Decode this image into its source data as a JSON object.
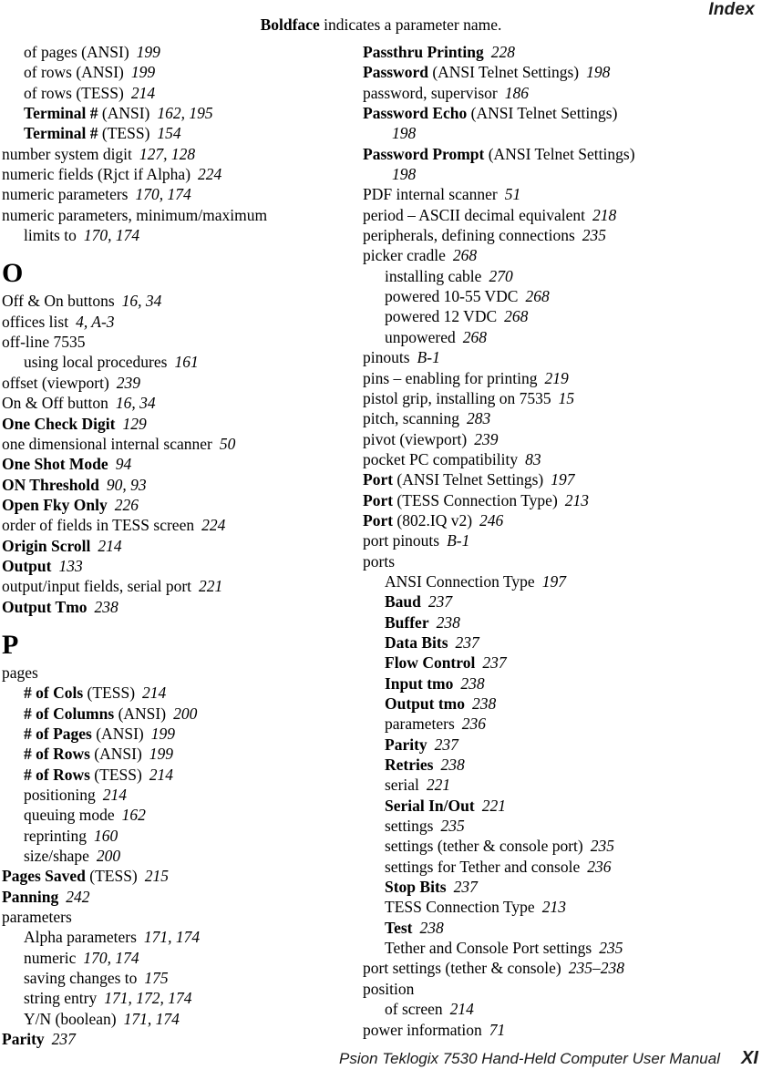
{
  "header": {
    "title": "Index"
  },
  "note": {
    "bold_word": "Boldface",
    "rest": " indicates a parameter name."
  },
  "footer": {
    "manual_title": "Psion Teklogix 7530 Hand-Held Computer User Manual",
    "page_number": "XI"
  },
  "columns": {
    "left": [
      {
        "kind": "entry",
        "level": 1,
        "bold": "",
        "text": "of pages (ANSI)",
        "pages": "199"
      },
      {
        "kind": "entry",
        "level": 1,
        "bold": "",
        "text": "of rows (ANSI)",
        "pages": "199"
      },
      {
        "kind": "entry",
        "level": 1,
        "bold": "",
        "text": "of rows (TESS)",
        "pages": "214"
      },
      {
        "kind": "entry",
        "level": 1,
        "bold": "Terminal #",
        "text": " (ANSI)",
        "pages": "162, 195"
      },
      {
        "kind": "entry",
        "level": 1,
        "bold": "Terminal #",
        "text": " (TESS)",
        "pages": "154"
      },
      {
        "kind": "entry",
        "level": 0,
        "bold": "",
        "text": "number system digit",
        "pages": "127, 128"
      },
      {
        "kind": "entry",
        "level": 0,
        "bold": "",
        "text": "numeric fields (Rjct if Alpha)",
        "pages": "224"
      },
      {
        "kind": "entry",
        "level": 0,
        "bold": "",
        "text": "numeric parameters",
        "pages": "170, 174"
      },
      {
        "kind": "entry",
        "level": 0,
        "bold": "",
        "text": "numeric parameters, minimum/maximum",
        "pages": ""
      },
      {
        "kind": "entry",
        "level": 1,
        "bold": "",
        "text": "limits to",
        "pages": "170, 174"
      },
      {
        "kind": "letter",
        "letter": "O"
      },
      {
        "kind": "entry",
        "level": 0,
        "bold": "",
        "text": "Off & On buttons",
        "pages": "16, 34"
      },
      {
        "kind": "entry",
        "level": 0,
        "bold": "",
        "text": "offices list",
        "pages": "4, A-3"
      },
      {
        "kind": "entry",
        "level": 0,
        "bold": "",
        "text": "off-line 7535",
        "pages": ""
      },
      {
        "kind": "entry",
        "level": 1,
        "bold": "",
        "text": "using local procedures",
        "pages": "161"
      },
      {
        "kind": "entry",
        "level": 0,
        "bold": "",
        "text": "offset (viewport)",
        "pages": "239"
      },
      {
        "kind": "entry",
        "level": 0,
        "bold": "",
        "text": "On & Off button",
        "pages": "16, 34"
      },
      {
        "kind": "entry",
        "level": 0,
        "bold": "One Check Digit",
        "text": "",
        "pages": "129"
      },
      {
        "kind": "entry",
        "level": 0,
        "bold": "",
        "text": "one dimensional internal scanner",
        "pages": "50"
      },
      {
        "kind": "entry",
        "level": 0,
        "bold": "One Shot Mode",
        "text": "",
        "pages": "94"
      },
      {
        "kind": "entry",
        "level": 0,
        "bold": "ON Threshold",
        "text": "",
        "pages": "90, 93"
      },
      {
        "kind": "entry",
        "level": 0,
        "bold": "Open Fky Only",
        "text": "",
        "pages": "226"
      },
      {
        "kind": "entry",
        "level": 0,
        "bold": "",
        "text": "order of fields in TESS screen",
        "pages": "224"
      },
      {
        "kind": "entry",
        "level": 0,
        "bold": "Origin Scroll",
        "text": "",
        "pages": "214"
      },
      {
        "kind": "entry",
        "level": 0,
        "bold": "Output",
        "text": "",
        "pages": "133"
      },
      {
        "kind": "entry",
        "level": 0,
        "bold": "",
        "text": "output/input fields, serial port",
        "pages": "221"
      },
      {
        "kind": "entry",
        "level": 0,
        "bold": "Output Tmo",
        "text": "",
        "pages": "238"
      },
      {
        "kind": "letter",
        "letter": "P"
      },
      {
        "kind": "entry",
        "level": 0,
        "bold": "",
        "text": "pages",
        "pages": ""
      },
      {
        "kind": "entry",
        "level": 1,
        "bold": "# of Cols",
        "text": " (TESS)",
        "pages": "214"
      },
      {
        "kind": "entry",
        "level": 1,
        "bold": "# of Columns",
        "text": " (ANSI)",
        "pages": "200"
      },
      {
        "kind": "entry",
        "level": 1,
        "bold": "# of Pages",
        "text": " (ANSI)",
        "pages": "199"
      },
      {
        "kind": "entry",
        "level": 1,
        "bold": "# of Rows",
        "text": " (ANSI)",
        "pages": "199"
      },
      {
        "kind": "entry",
        "level": 1,
        "bold": "# of Rows",
        "text": " (TESS)",
        "pages": "214"
      },
      {
        "kind": "entry",
        "level": 1,
        "bold": "",
        "text": "positioning",
        "pages": "214"
      },
      {
        "kind": "entry",
        "level": 1,
        "bold": "",
        "text": "queuing mode",
        "pages": "162"
      },
      {
        "kind": "entry",
        "level": 1,
        "bold": "",
        "text": "reprinting",
        "pages": "160"
      },
      {
        "kind": "entry",
        "level": 1,
        "bold": "",
        "text": "size/shape",
        "pages": "200"
      },
      {
        "kind": "entry",
        "level": 0,
        "bold": "Pages Saved",
        "text": " (TESS)",
        "pages": "215"
      },
      {
        "kind": "entry",
        "level": 0,
        "bold": "Panning",
        "text": "",
        "pages": "242"
      },
      {
        "kind": "entry",
        "level": 0,
        "bold": "",
        "text": "parameters",
        "pages": ""
      },
      {
        "kind": "entry",
        "level": 1,
        "bold": "",
        "text": "Alpha parameters",
        "pages": "171, 174"
      },
      {
        "kind": "entry",
        "level": 1,
        "bold": "",
        "text": "numeric",
        "pages": "170, 174"
      },
      {
        "kind": "entry",
        "level": 1,
        "bold": "",
        "text": "saving changes to",
        "pages": "175"
      },
      {
        "kind": "entry",
        "level": 1,
        "bold": "",
        "text": "string entry",
        "pages": "171, 172, 174"
      },
      {
        "kind": "entry",
        "level": 1,
        "bold": "",
        "text": "Y/N (boolean)",
        "pages": "171, 174"
      },
      {
        "kind": "entry",
        "level": 0,
        "bold": "Parity",
        "text": "",
        "pages": "237"
      }
    ],
    "right": [
      {
        "kind": "entry",
        "level": 0,
        "bold": "Passthru Printing",
        "text": "",
        "pages": "228"
      },
      {
        "kind": "entry",
        "level": 0,
        "bold": "Password",
        "text": " (ANSI Telnet Settings)",
        "pages": "198"
      },
      {
        "kind": "entry",
        "level": 0,
        "bold": "",
        "text": "password, supervisor",
        "pages": "186"
      },
      {
        "kind": "entry",
        "level": 0,
        "bold": "Password Echo",
        "text": " (ANSI Telnet Settings)",
        "pages": ""
      },
      {
        "kind": "entry",
        "level": 1,
        "bold": "",
        "text": "",
        "pages": "198"
      },
      {
        "kind": "entry",
        "level": 0,
        "bold": "Password Prompt",
        "text": " (ANSI Telnet Settings)",
        "pages": ""
      },
      {
        "kind": "entry",
        "level": 1,
        "bold": "",
        "text": "",
        "pages": "198"
      },
      {
        "kind": "entry",
        "level": 0,
        "bold": "",
        "text": "PDF internal scanner",
        "pages": "51"
      },
      {
        "kind": "entry",
        "level": 0,
        "bold": "",
        "text": "period – ASCII decimal equivalent",
        "pages": "218"
      },
      {
        "kind": "entry",
        "level": 0,
        "bold": "",
        "text": "peripherals, defining connections",
        "pages": "235"
      },
      {
        "kind": "entry",
        "level": 0,
        "bold": "",
        "text": "picker cradle",
        "pages": "268"
      },
      {
        "kind": "entry",
        "level": 1,
        "bold": "",
        "text": "installing cable",
        "pages": "270"
      },
      {
        "kind": "entry",
        "level": 1,
        "bold": "",
        "text": "powered 10-55 VDC",
        "pages": "268"
      },
      {
        "kind": "entry",
        "level": 1,
        "bold": "",
        "text": "powered 12 VDC",
        "pages": "268"
      },
      {
        "kind": "entry",
        "level": 1,
        "bold": "",
        "text": "unpowered",
        "pages": "268"
      },
      {
        "kind": "entry",
        "level": 0,
        "bold": "",
        "text": "pinouts",
        "pages": "B-1"
      },
      {
        "kind": "entry",
        "level": 0,
        "bold": "",
        "text": "pins – enabling for printing",
        "pages": "219"
      },
      {
        "kind": "entry",
        "level": 0,
        "bold": "",
        "text": "pistol grip, installing on 7535",
        "pages": "15"
      },
      {
        "kind": "entry",
        "level": 0,
        "bold": "",
        "text": "pitch, scanning",
        "pages": "283"
      },
      {
        "kind": "entry",
        "level": 0,
        "bold": "",
        "text": "pivot (viewport)",
        "pages": "239"
      },
      {
        "kind": "entry",
        "level": 0,
        "bold": "",
        "text": "pocket PC compatibility",
        "pages": "83"
      },
      {
        "kind": "entry",
        "level": 0,
        "bold": "Port",
        "text": " (ANSI Telnet Settings)",
        "pages": "197"
      },
      {
        "kind": "entry",
        "level": 0,
        "bold": "Port",
        "text": " (TESS Connection Type)",
        "pages": "213"
      },
      {
        "kind": "entry",
        "level": 0,
        "bold": "Port",
        "text": " (802.IQ v2)",
        "pages": "246"
      },
      {
        "kind": "entry",
        "level": 0,
        "bold": "",
        "text": "port pinouts",
        "pages": "B-1"
      },
      {
        "kind": "entry",
        "level": 0,
        "bold": "",
        "text": "ports",
        "pages": ""
      },
      {
        "kind": "entry",
        "level": 1,
        "bold": "",
        "text": "ANSI Connection Type",
        "pages": "197"
      },
      {
        "kind": "entry",
        "level": 1,
        "bold": "Baud",
        "text": "",
        "pages": "237"
      },
      {
        "kind": "entry",
        "level": 1,
        "bold": "Buffer",
        "text": "",
        "pages": "238"
      },
      {
        "kind": "entry",
        "level": 1,
        "bold": "Data Bits",
        "text": "",
        "pages": "237"
      },
      {
        "kind": "entry",
        "level": 1,
        "bold": "Flow Control",
        "text": "",
        "pages": "237"
      },
      {
        "kind": "entry",
        "level": 1,
        "bold": "Input tmo",
        "text": "",
        "pages": "238"
      },
      {
        "kind": "entry",
        "level": 1,
        "bold": "Output tmo",
        "text": "",
        "pages": "238"
      },
      {
        "kind": "entry",
        "level": 1,
        "bold": "",
        "text": "parameters",
        "pages": "236"
      },
      {
        "kind": "entry",
        "level": 1,
        "bold": "Parity",
        "text": "",
        "pages": "237"
      },
      {
        "kind": "entry",
        "level": 1,
        "bold": "Retries",
        "text": "",
        "pages": "238"
      },
      {
        "kind": "entry",
        "level": 1,
        "bold": "",
        "text": "serial",
        "pages": "221"
      },
      {
        "kind": "entry",
        "level": 1,
        "bold": "Serial In/Out",
        "text": "",
        "pages": "221"
      },
      {
        "kind": "entry",
        "level": 1,
        "bold": "",
        "text": "settings",
        "pages": "235"
      },
      {
        "kind": "entry",
        "level": 1,
        "bold": "",
        "text": "settings (tether & console port)",
        "pages": "235"
      },
      {
        "kind": "entry",
        "level": 1,
        "bold": "",
        "text": "settings for Tether and console",
        "pages": "236"
      },
      {
        "kind": "entry",
        "level": 1,
        "bold": "Stop Bits",
        "text": "",
        "pages": "237"
      },
      {
        "kind": "entry",
        "level": 1,
        "bold": "",
        "text": "TESS Connection Type",
        "pages": "213"
      },
      {
        "kind": "entry",
        "level": 1,
        "bold": "Test",
        "text": "",
        "pages": "238"
      },
      {
        "kind": "entry",
        "level": 1,
        "bold": "",
        "text": "Tether and Console Port settings",
        "pages": "235"
      },
      {
        "kind": "entry",
        "level": 0,
        "bold": "",
        "text": "port settings (tether & console)",
        "pages": "235–238"
      },
      {
        "kind": "entry",
        "level": 0,
        "bold": "",
        "text": "position",
        "pages": ""
      },
      {
        "kind": "entry",
        "level": 1,
        "bold": "",
        "text": "of screen",
        "pages": "214"
      },
      {
        "kind": "entry",
        "level": 0,
        "bold": "",
        "text": "power information",
        "pages": "71"
      }
    ]
  }
}
